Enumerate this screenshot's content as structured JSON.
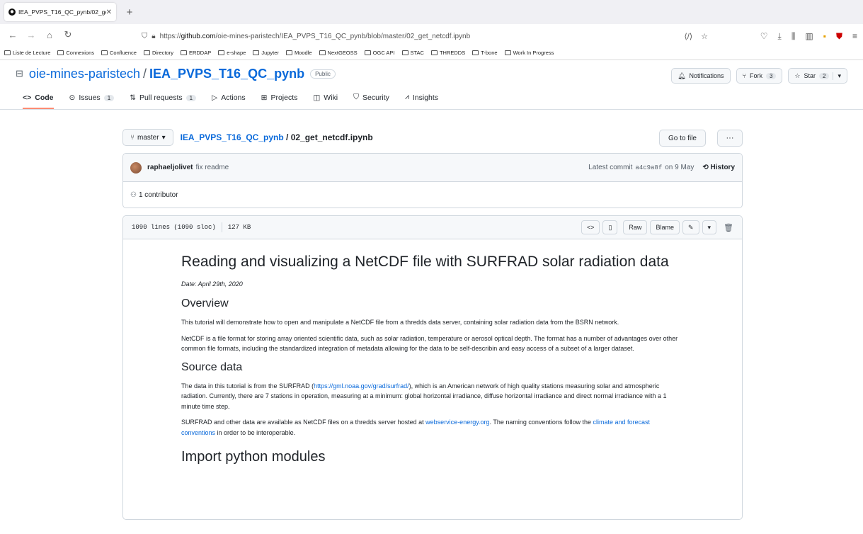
{
  "browser": {
    "tab_title": "IEA_PVPS_T16_QC_pynb/02_ge",
    "url_prefix": "https://",
    "url_host": "github.com",
    "url_path": "/oie-mines-paristech/IEA_PVPS_T16_QC_pynb/blob/master/02_get_netcdf.ipynb"
  },
  "bookmarks": [
    "Liste de Lecture",
    "Connexions",
    "Confluence",
    "Directory",
    "ERDDAP",
    "e-shape",
    "Jupyter",
    "Moodle",
    "NextGEOSS",
    "OGC API",
    "STAC",
    "THREDDS",
    "T-bone",
    "Work In Progress"
  ],
  "repo": {
    "owner": "oie-mines-paristech",
    "separator": "/",
    "name": "IEA_PVPS_T16_QC_pynb",
    "visibility": "Public",
    "notifications": "Notifications",
    "fork_label": "Fork",
    "fork_count": "3",
    "star_label": "Star",
    "star_count": "2"
  },
  "nav": {
    "code": "Code",
    "issues": "Issues",
    "issues_count": "1",
    "pulls": "Pull requests",
    "pulls_count": "1",
    "actions": "Actions",
    "projects": "Projects",
    "wiki": "Wiki",
    "security": "Security",
    "insights": "Insights"
  },
  "file": {
    "branch": "master",
    "repo_link": "IEA_PVPS_T16_QC_pynb",
    "path_sep": "/",
    "filename": "02_get_netcdf.ipynb",
    "go_to_file": "Go to file",
    "more": "···"
  },
  "commit": {
    "author": "raphaeljolivet",
    "message": "fix readme",
    "latest": "Latest commit",
    "sha": "a4c9a8f",
    "date": "on 9 May",
    "history": "History",
    "contributors": "1 contributor"
  },
  "filehead": {
    "lines": "1090 lines (1090 sloc)",
    "size": "127 KB",
    "raw": "Raw",
    "blame": "Blame"
  },
  "notebook": {
    "title": "Reading and visualizing a NetCDF file with SURFRAD solar radiation data",
    "date": "Date: April 29th, 2020",
    "overview_h": "Overview",
    "overview_p": "This tutorial will demonstrate how to open and manipulate a NetCDF file from a thredds data server, containing solar radiation data from the BSRN network.",
    "netcdf_p": "NetCDF is a file format for storing array oriented scientific data, such as solar radiation, temperature or aerosol optical depth. The format has a number of advantages over other common file formats, including the standardized integration of metadata allowing for the data to be self-describin and easy access of a subset of a larger dataset.",
    "source_h": "Source data",
    "source_p1a": "The data in this tutorial is from the SURFRAD (",
    "source_link": "https://gml.noaa.gov/grad/surfrad/",
    "source_p1b": "), which is an American network of high quality stations measuring solar and atmospheric radiation. Currently, there are 7 stations in operation, measuring at a minimum: global horizontal irradiance, diffuse horizontal irradiance and direct normal irradiance with a 1 minute time step.",
    "source_p2a": "SURFRAD and other data are available as NetCDF files on a thredds server hosted at ",
    "source_p2_link": "webservice-energy.org",
    "source_p2b": ". The naming conventions follow the ",
    "source_p2_link2": "climate and forecast conventions",
    "source_p2c": " in order to be interoperable.",
    "import_h": "Import python modules"
  }
}
